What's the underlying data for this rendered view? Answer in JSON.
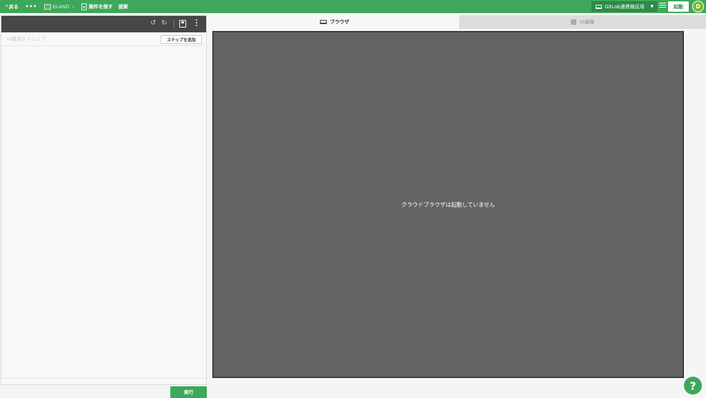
{
  "topbar": {
    "back_label": "戻る",
    "more_label": "•••",
    "breadcrumb": [
      "ELAND",
      "案件を探す",
      "提案"
    ],
    "environment_label": "GitLab連携検証用",
    "launch_label": "起動",
    "avatar_initial": "D",
    "bg_color": "#3da85a"
  },
  "left_panel": {
    "drop_placeholder": "UI要素をドロップ",
    "add_step_label": "ステップを追加",
    "run_label": "実行"
  },
  "tabs": [
    {
      "label": "ブラウザ",
      "icon": "laptop-icon",
      "active": true
    },
    {
      "label": "UI画像",
      "icon": "image-icon",
      "active": false
    }
  ],
  "browser": {
    "message": "クラウドブラウザは起動していません"
  },
  "help_label": "?"
}
